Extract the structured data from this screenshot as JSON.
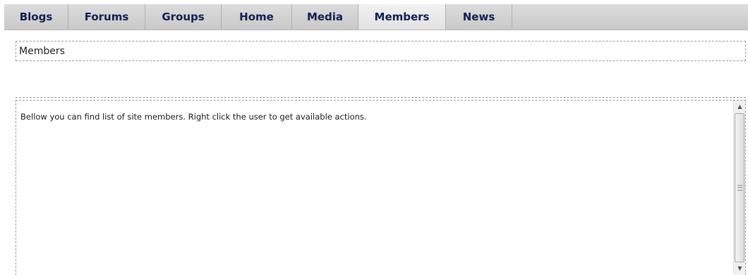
{
  "tabs": [
    {
      "label": "Blogs"
    },
    {
      "label": "Forums"
    },
    {
      "label": "Groups"
    },
    {
      "label": "Home"
    },
    {
      "label": "Media"
    },
    {
      "label": "Members",
      "active": true
    },
    {
      "label": "News"
    }
  ],
  "page_title": "Members",
  "content": {
    "description": "Bellow you can find list of site members. Right click the user to get available actions."
  },
  "scrollbar": {
    "up_icon": "arrow-up-icon",
    "down_icon": "arrow-down-icon",
    "grip_icon": "grip-icon"
  }
}
